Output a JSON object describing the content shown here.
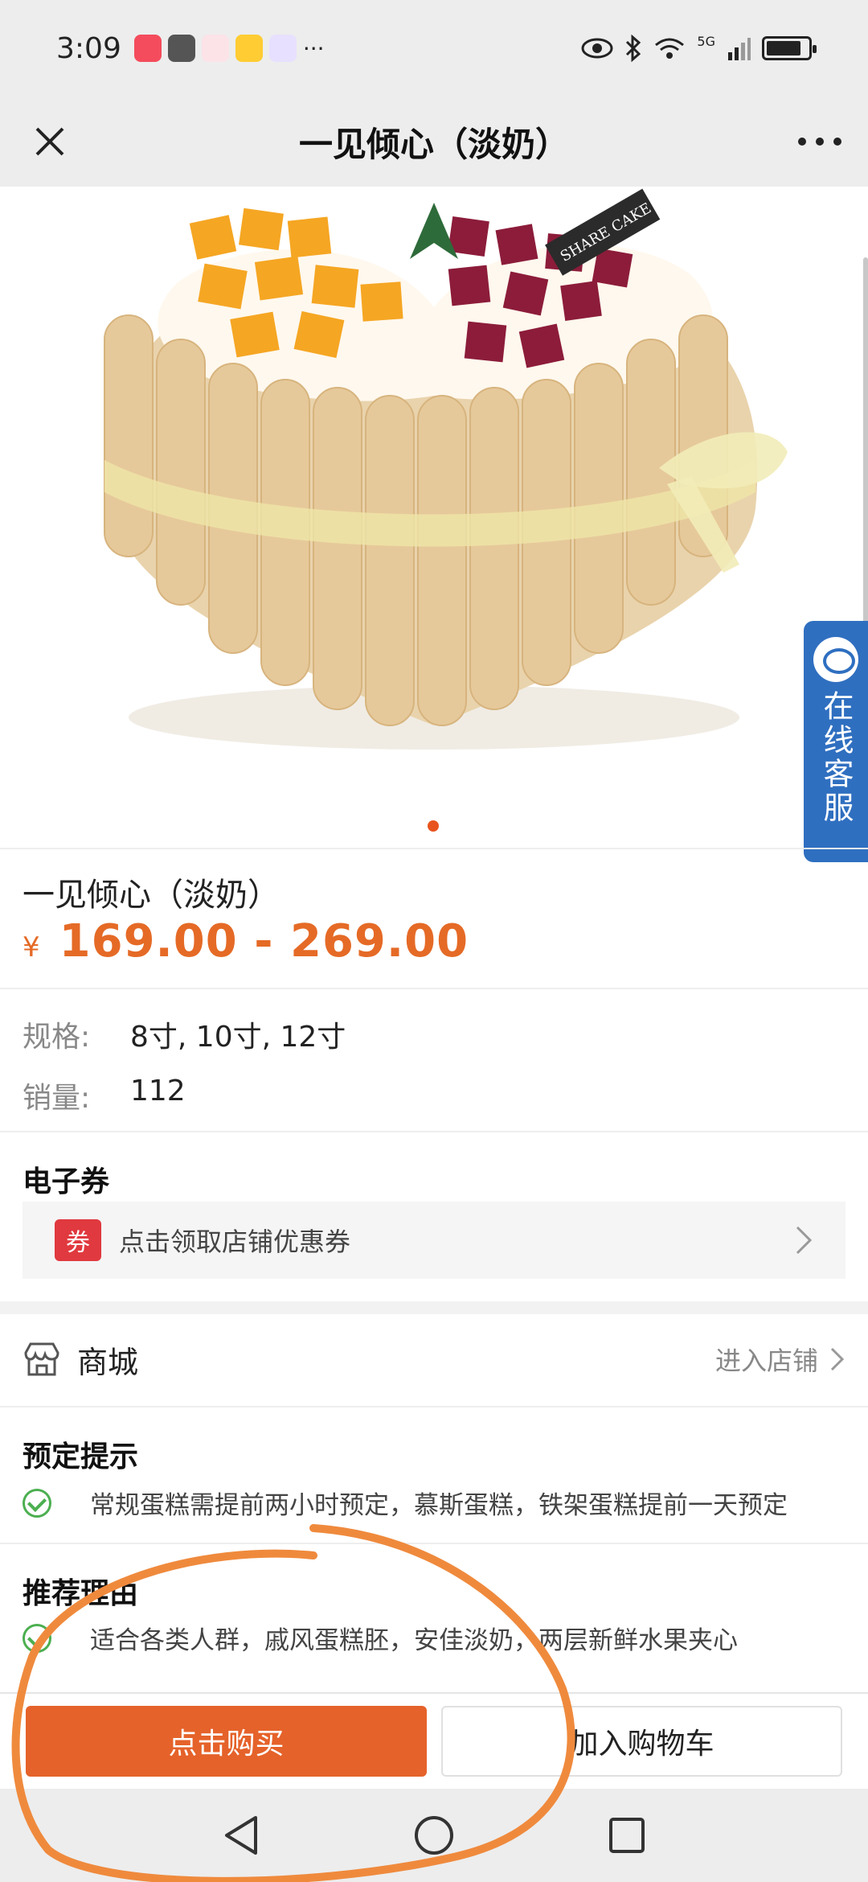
{
  "status_bar": {
    "time": "3:09",
    "network": "5G",
    "dots": "···"
  },
  "title_bar": {
    "title": "一见倾心（淡奶）"
  },
  "product": {
    "name": "一见倾心（淡奶）",
    "currency": "¥",
    "price_range": "169.00 - 269.00",
    "spec_label": "规格:",
    "spec_value": "8寸, 10寸, 12寸",
    "sales_label": "销量:",
    "sales_value": "112",
    "carousel_index": 1,
    "carousel_total": 1,
    "cake_tag": "SHARE CAKE"
  },
  "customer_service": {
    "label": "在线客服"
  },
  "coupon": {
    "section_title": "电子券",
    "badge": "券",
    "text": "点击领取店铺优惠券"
  },
  "store": {
    "label": "商城",
    "link": "进入店铺"
  },
  "booking_tip": {
    "title": "预定提示",
    "text": "常规蛋糕需提前两小时预定，慕斯蛋糕，铁架蛋糕提前一天预定"
  },
  "recommend": {
    "title": "推荐理由",
    "text": "适合各类人群，戚风蛋糕胚，安佳淡奶，两层新鲜水果夹心"
  },
  "actions": {
    "buy": "点击购买",
    "add_cart": "加入购物车"
  },
  "colors": {
    "accent": "#e5622a",
    "price": "#e56a26",
    "service_blue": "#2f6fc0",
    "coupon_red": "#e0393f",
    "check_green": "#4caf50"
  }
}
